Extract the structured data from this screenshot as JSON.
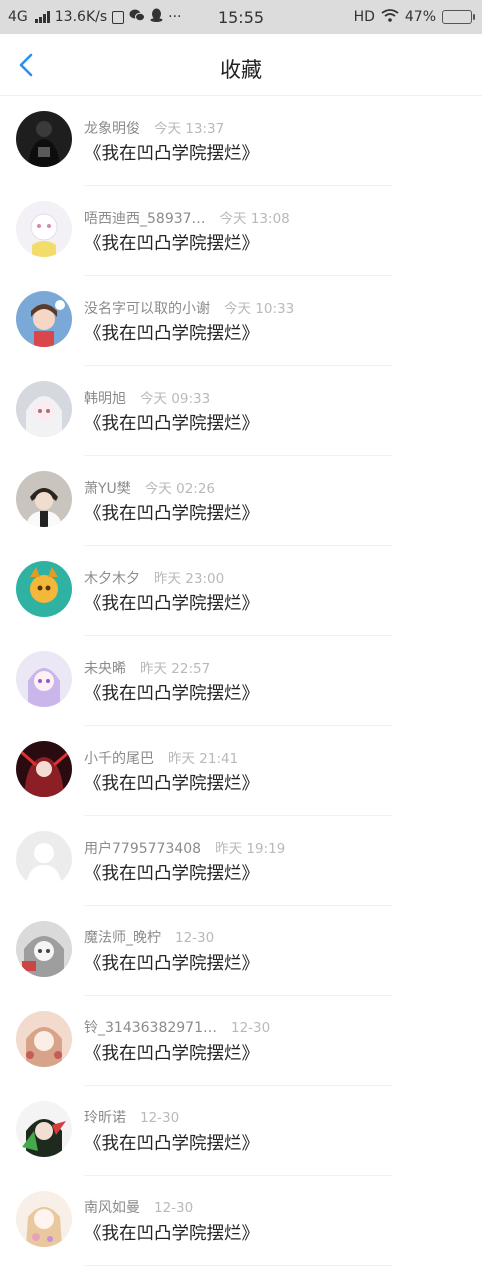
{
  "status_bar": {
    "network": "4G",
    "speed": "13.6K/s",
    "icons": [
      "sim-card-icon",
      "wechat-icon",
      "qq-penguin-icon",
      "more-dots-icon"
    ],
    "more": "···",
    "time": "15:55",
    "hd": "HD",
    "battery_text": "47%",
    "battery_level": 0.47
  },
  "header": {
    "title": "收藏",
    "back_icon": "chevron-left-icon"
  },
  "colors": {
    "accent": "#2b8ff0",
    "status_bg": "#dcdcdc",
    "meta_text": "#8b8b8b",
    "time_text": "#b9b9b9",
    "title_text": "#222222"
  },
  "items": [
    {
      "name": "龙象明俊",
      "time": "今天 13:37",
      "title": "《我在凹凸学院摆烂》"
    },
    {
      "name": "唔西迪西_58937…",
      "time": "今天 13:08",
      "title": "《我在凹凸学院摆烂》"
    },
    {
      "name": "没名字可以取的小谢",
      "time": "今天 10:33",
      "title": "《我在凹凸学院摆烂》"
    },
    {
      "name": "韩明旭",
      "time": "今天 09:33",
      "title": "《我在凹凸学院摆烂》"
    },
    {
      "name": "萧YU樊",
      "time": "今天 02:26",
      "title": "《我在凹凸学院摆烂》"
    },
    {
      "name": "木夕木夕",
      "time": "昨天 23:00",
      "title": "《我在凹凸学院摆烂》"
    },
    {
      "name": "未央晞",
      "time": "昨天 22:57",
      "title": "《我在凹凸学院摆烂》"
    },
    {
      "name": "小千的尾巴",
      "time": "昨天 21:41",
      "title": "《我在凹凸学院摆烂》"
    },
    {
      "name": "用户7795773408",
      "time": "昨天 19:19",
      "title": "《我在凹凸学院摆烂》"
    },
    {
      "name": "魔法师_晚柠",
      "time": "12-30",
      "title": "《我在凹凸学院摆烂》"
    },
    {
      "name": "铃_31436382971…",
      "time": "12-30",
      "title": "《我在凹凸学院摆烂》"
    },
    {
      "name": "玲昕诺",
      "time": "12-30",
      "title": "《我在凹凸学院摆烂》"
    },
    {
      "name": "南风如曼",
      "time": "12-30",
      "title": "《我在凹凸学院摆烂》"
    }
  ]
}
